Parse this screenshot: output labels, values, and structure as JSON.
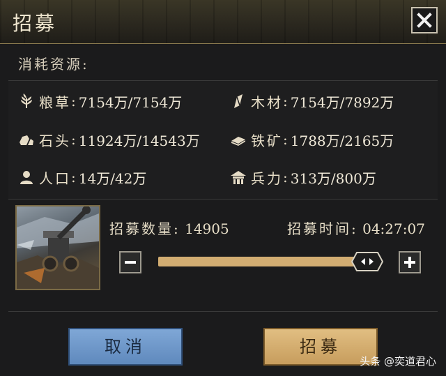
{
  "dialog": {
    "title": "招募"
  },
  "resources": {
    "label": "消耗资源:",
    "items": [
      {
        "name": "粮草",
        "value": "7154万/7154万",
        "icon": "wheat-icon"
      },
      {
        "name": "木材",
        "value": "7154万/7892万",
        "icon": "wood-icon"
      },
      {
        "name": "石头",
        "value": "11924万/14543万",
        "icon": "stone-icon"
      },
      {
        "name": "铁矿",
        "value": "1788万/2165万",
        "icon": "iron-icon"
      },
      {
        "name": "人口",
        "value": "14万/42万",
        "icon": "person-icon"
      },
      {
        "name": "兵力",
        "value": "313万/800万",
        "icon": "barracks-icon"
      }
    ],
    "separator": ":"
  },
  "recruit": {
    "quantity_label": "招募数量:",
    "quantity": "14905",
    "time_label": "招募时间:",
    "time": "04:27:07",
    "slider_fraction": 0.97
  },
  "buttons": {
    "cancel": "取消",
    "confirm": "招募"
  },
  "watermark": "头条 @奕道君心",
  "colors": {
    "accent": "#d2ad72",
    "cancel": "#6f98ca",
    "confirm": "#d6b072"
  }
}
